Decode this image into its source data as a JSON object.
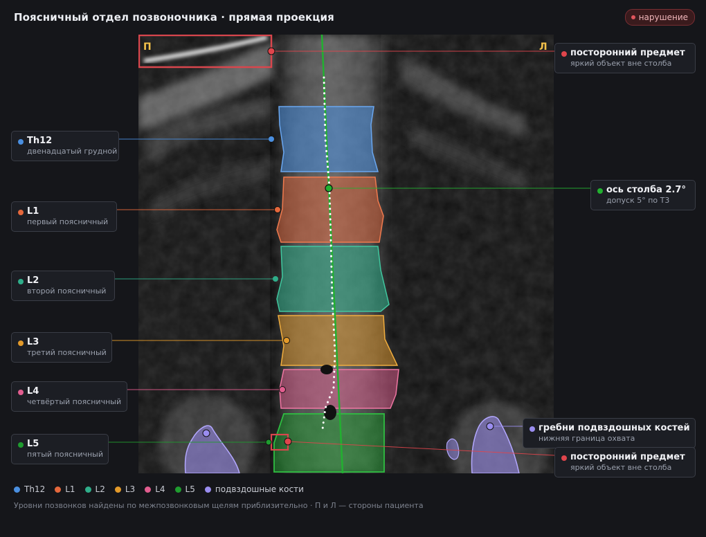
{
  "title": "Поясничный отдел позвоночника · прямая проекция",
  "badge": {
    "label": "нарушение",
    "color": "#e0555c"
  },
  "viewport": {
    "right_marker": "П",
    "left_marker": "Л",
    "marker_color": "#f3c14a"
  },
  "vertebrae": [
    {
      "id": "Th12",
      "name": "Th12",
      "desc": "двенадцатый грудной",
      "color": "#4a8fe0"
    },
    {
      "id": "L1",
      "name": "L1",
      "desc": "первый поясничный",
      "color": "#e5683c"
    },
    {
      "id": "L2",
      "name": "L2",
      "desc": "второй поясничный",
      "color": "#2fae8a"
    },
    {
      "id": "L3",
      "name": "L3",
      "desc": "третий поясничный",
      "color": "#e39a2a"
    },
    {
      "id": "L4",
      "name": "L4",
      "desc": "четвёртый поясничный",
      "color": "#e25d8f"
    },
    {
      "id": "L5",
      "name": "L5",
      "desc": "пятый поясничный",
      "color": "#1f9c2f"
    }
  ],
  "axis": {
    "name": "ось столба 2.7°",
    "desc": "допуск 5° по Т3",
    "color": "#22b030"
  },
  "foreign_objects": [
    {
      "name": "посторонний предмет",
      "desc": "яркий объект вне столба",
      "color": "#e0454c"
    },
    {
      "name": "посторонний предмет",
      "desc": "яркий объект вне столба",
      "color": "#e0454c"
    }
  ],
  "iliac": {
    "name": "гребни подвздошных костей",
    "desc": "нижняя граница охвата",
    "color": "#9a8df0"
  },
  "legend": [
    {
      "label": "Th12",
      "color": "#4a8fe0"
    },
    {
      "label": "L1",
      "color": "#e5683c"
    },
    {
      "label": "L2",
      "color": "#2fae8a"
    },
    {
      "label": "L3",
      "color": "#e39a2a"
    },
    {
      "label": "L4",
      "color": "#e25d8f"
    },
    {
      "label": "L5",
      "color": "#1f9c2f"
    },
    {
      "label": "подвздошные кости",
      "color": "#9a8df0"
    }
  ],
  "footnote": "Уровни позвонков найдены по межпозвонковым щелям приблизительно · П и Л — стороны пациента"
}
